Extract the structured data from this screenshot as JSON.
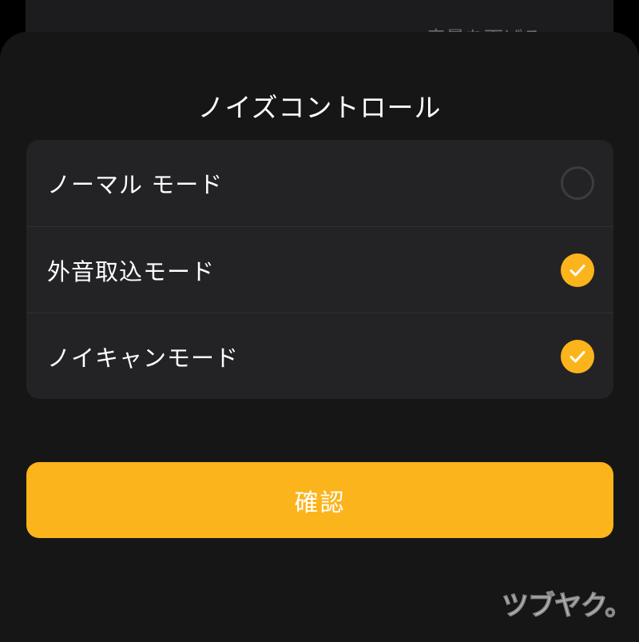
{
  "background_screen": {
    "partial_text": "音量を下げる"
  },
  "sheet": {
    "title": "ノイズコントロール",
    "options": [
      {
        "label": "ノーマル モード",
        "checked": false,
        "icon": "radio-unchecked-icon"
      },
      {
        "label": "外音取込モード",
        "checked": true,
        "icon": "checkmark-icon"
      },
      {
        "label": "ノイキャンモード",
        "checked": true,
        "icon": "checkmark-icon"
      }
    ],
    "confirm_label": "確認"
  },
  "watermark": {
    "text": "ツブヤク。"
  },
  "colors": {
    "accent": "#fbb41b",
    "sheet_background": "#161616",
    "card_background": "#232325",
    "text_primary": "#ffffff",
    "radio_border": "#3c3c3f"
  }
}
